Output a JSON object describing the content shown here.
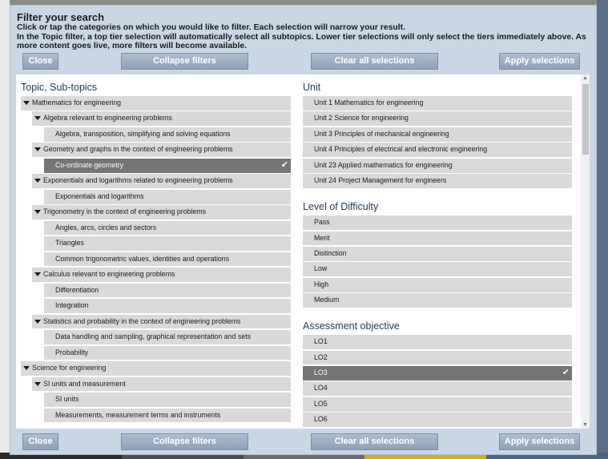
{
  "header": {
    "title": "Filter your search",
    "line1": "Click or tap the categories on which you would like to filter. Each selection will narrow your result.",
    "line2": "In the Topic filter, a top tier selection will automatically select all subtopics. Lower tier selections will only select the tiers immediately above. As more content goes live, more filters will become available."
  },
  "buttons": {
    "close": "Close",
    "collapse": "Collapse filters",
    "clear": "Clear all selections",
    "apply": "Apply selections"
  },
  "topics": {
    "title": "Topic, Sub-topics",
    "items": [
      {
        "label": "Mathematics for engineering",
        "level": 0,
        "caret": true,
        "selected": false
      },
      {
        "label": "Algebra relevant to engineering problems",
        "level": 1,
        "caret": true,
        "selected": false
      },
      {
        "label": "Algebra, transposition, simplifying and solving equations",
        "level": 2,
        "caret": false,
        "selected": false
      },
      {
        "label": "Geometry and graphs in the context of engineering problems",
        "level": 1,
        "caret": true,
        "selected": false
      },
      {
        "label": "Co-ordinate geometry",
        "level": 2,
        "caret": false,
        "selected": true
      },
      {
        "label": "Exponentials and logarithms related to engineering problems",
        "level": 1,
        "caret": true,
        "selected": false
      },
      {
        "label": "Exponentials and logarithms",
        "level": 2,
        "caret": false,
        "selected": false
      },
      {
        "label": "Trigonometry in the context of engineering problems",
        "level": 1,
        "caret": true,
        "selected": false
      },
      {
        "label": "Angles, arcs, circles and sectors",
        "level": 2,
        "caret": false,
        "selected": false
      },
      {
        "label": "Triangles",
        "level": 2,
        "caret": false,
        "selected": false
      },
      {
        "label": "Common trigonometric values, identities and operations",
        "level": 2,
        "caret": false,
        "selected": false
      },
      {
        "label": "Calculus relevant to engineering problems",
        "level": 1,
        "caret": true,
        "selected": false
      },
      {
        "label": "Differentiation",
        "level": 2,
        "caret": false,
        "selected": false
      },
      {
        "label": "Integration",
        "level": 2,
        "caret": false,
        "selected": false
      },
      {
        "label": "Statistics and probability in the context of engineering problems",
        "level": 1,
        "caret": true,
        "selected": false
      },
      {
        "label": "Data handling and sampling, graphical representation and sets",
        "level": 2,
        "caret": false,
        "selected": false
      },
      {
        "label": "Probability",
        "level": 2,
        "caret": false,
        "selected": false
      },
      {
        "label": "Science for engineering",
        "level": 0,
        "caret": true,
        "selected": false
      },
      {
        "label": "SI units and measurement",
        "level": 1,
        "caret": true,
        "selected": false
      },
      {
        "label": "SI units",
        "level": 2,
        "caret": false,
        "selected": false
      },
      {
        "label": "Measurements, measurement terms and instruments",
        "level": 2,
        "caret": false,
        "selected": false
      }
    ]
  },
  "units": {
    "title": "Unit",
    "items": [
      {
        "label": "Unit 1 Mathematics for engineering",
        "selected": false
      },
      {
        "label": "Unit 2 Science for engineering",
        "selected": false
      },
      {
        "label": "Unit 3 Principles of mechanical engineering",
        "selected": false
      },
      {
        "label": "Unit 4 Principles of electrical and electronic engineering",
        "selected": false
      },
      {
        "label": "Unit 23 Applied mathematics for engineering",
        "selected": false
      },
      {
        "label": "Unit 24 Project Management for engineers",
        "selected": false
      }
    ]
  },
  "difficulty": {
    "title": "Level of Difficulty",
    "items": [
      {
        "label": "Pass",
        "selected": false
      },
      {
        "label": "Merit",
        "selected": false
      },
      {
        "label": "Distinction",
        "selected": false
      },
      {
        "label": "Low",
        "selected": false
      },
      {
        "label": "High",
        "selected": false
      },
      {
        "label": "Medium",
        "selected": false
      }
    ]
  },
  "objectives": {
    "title": "Assessment objective",
    "items": [
      {
        "label": "LO1",
        "selected": false
      },
      {
        "label": "LO2",
        "selected": false
      },
      {
        "label": "LO3",
        "selected": true
      },
      {
        "label": "LO4",
        "selected": false
      },
      {
        "label": "LO5",
        "selected": false
      },
      {
        "label": "LO6",
        "selected": false
      }
    ]
  },
  "icons": {
    "check": "checkmark-icon",
    "caret": "caret-down-icon"
  },
  "colors": {
    "modal_bg": "#c9d7e5",
    "button": "#8ea1b8",
    "row": "#d9d9d9",
    "row_selected": "#757575",
    "section_title": "#1f3c5c"
  }
}
